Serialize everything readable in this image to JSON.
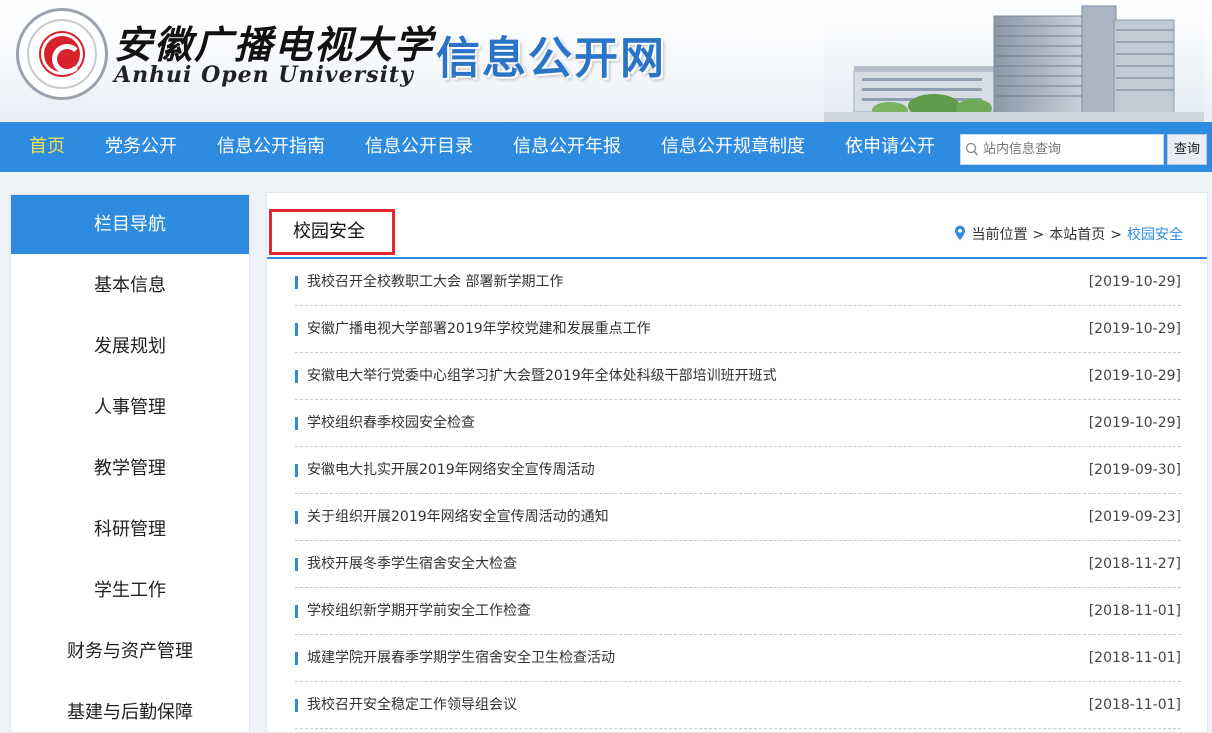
{
  "header": {
    "logo_cn": "安徽广播电视大学",
    "logo_en": "Anhui Open University",
    "site_title": "信息公开网",
    "logo_icon": "university-seal-icon"
  },
  "nav": {
    "items": [
      {
        "label": "首页",
        "active": true
      },
      {
        "label": "党务公开"
      },
      {
        "label": "信息公开指南"
      },
      {
        "label": "信息公开目录"
      },
      {
        "label": "信息公开年报"
      },
      {
        "label": "信息公开规章制度"
      },
      {
        "label": "依申请公开"
      }
    ],
    "search_placeholder": "站内信息查询",
    "search_button": "查询"
  },
  "sidebar": {
    "heading": "栏目导航",
    "items": [
      {
        "label": "基本信息"
      },
      {
        "label": "发展规划"
      },
      {
        "label": "人事管理"
      },
      {
        "label": "教学管理"
      },
      {
        "label": "科研管理"
      },
      {
        "label": "学生工作"
      },
      {
        "label": "财务与资产管理"
      },
      {
        "label": "基建与后勤保障"
      }
    ]
  },
  "main": {
    "category_title": "校园安全",
    "breadcrumb": {
      "prefix": "当前位置",
      "home": "本站首页",
      "current": "校园安全"
    },
    "articles": [
      {
        "title": "我校召开全校教职工大会 部署新学期工作",
        "date": "[2019-10-29]"
      },
      {
        "title": "安徽广播电视大学部署2019年学校党建和发展重点工作",
        "date": "[2019-10-29]"
      },
      {
        "title": "安徽电大举行党委中心组学习扩大会暨2019年全体处科级干部培训班开班式",
        "date": "[2019-10-29]"
      },
      {
        "title": "学校组织春季校园安全检查",
        "date": "[2019-10-29]"
      },
      {
        "title": "安徽电大扎实开展2019年网络安全宣传周活动",
        "date": "[2019-09-30]"
      },
      {
        "title": "关于组织开展2019年网络安全宣传周活动的通知",
        "date": "[2019-09-23]"
      },
      {
        "title": "我校开展冬季学生宿舍安全大检查",
        "date": "[2018-11-27]"
      },
      {
        "title": "学校组织新学期开学前安全工作检查",
        "date": "[2018-11-01]"
      },
      {
        "title": "城建学院开展春季学期学生宿舍安全卫生检查活动",
        "date": "[2018-11-01]"
      },
      {
        "title": "我校召开安全稳定工作领导组会议",
        "date": "[2018-11-01]"
      }
    ]
  },
  "colors": {
    "primary": "#2d8be0",
    "nav_active": "#f5e04a",
    "highlight_border": "#e0282e",
    "title_blue": "#2a74c8"
  }
}
